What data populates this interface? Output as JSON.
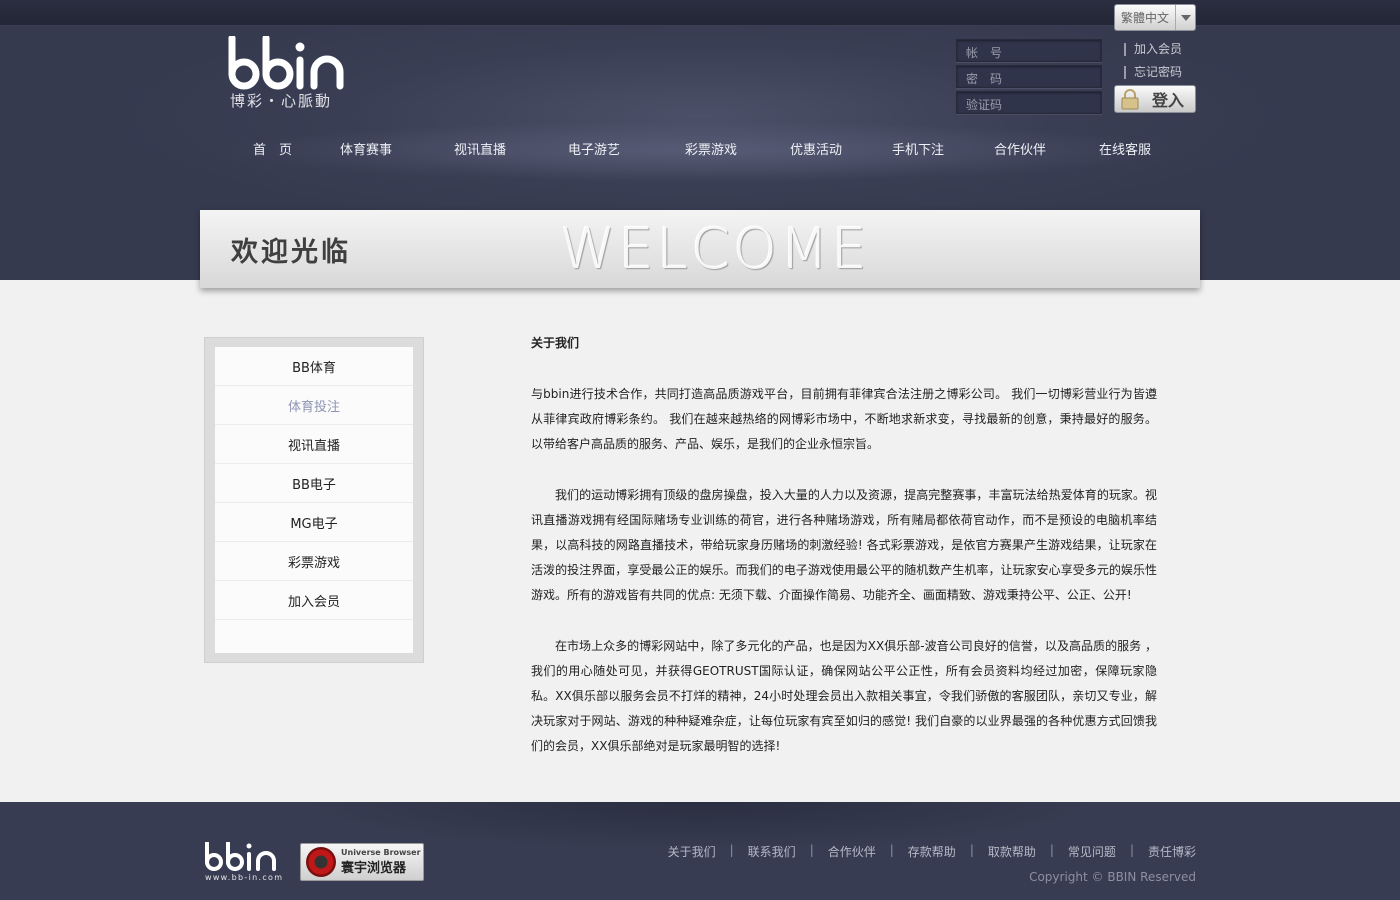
{
  "header": {
    "language_select": "繁體中文",
    "logo_tagline": "博彩・心脈動",
    "login": {
      "account_placeholder": "帐　号",
      "password_placeholder": "密　码",
      "captcha_placeholder": "验证码",
      "join_link": "加入会员",
      "forgot_link": "忘记密码",
      "login_button": "登入"
    },
    "nav": [
      "首　页",
      "体育赛事",
      "视讯直播",
      "电子游艺",
      "彩票游戏",
      "优惠活动",
      "手机下注",
      "合作伙伴",
      "在线客服"
    ]
  },
  "banner": {
    "title_cn": "欢迎光临",
    "title_en": "WELCOME"
  },
  "sidebar": {
    "items": [
      "BB体育",
      "体育投注",
      "视讯直播",
      "BB电子",
      "MG电子",
      "彩票游戏",
      "加入会员"
    ],
    "active_index": 1
  },
  "content": {
    "heading": "关于我们",
    "paragraphs": [
      "与bbin进行技术合作，共同打造高品质游戏平台，目前拥有菲律宾合法注册之博彩公司。 我们一切博彩营业行为皆遵从菲律宾政府博彩条约。 我们在越来越热络的网博彩市场中，不断地求新求变，寻找最新的创意，秉持最好的服务。以带给客户高品质的服务、产品、娱乐，是我们的企业永恒宗旨。",
      "我们的运动博彩拥有顶级的盘房操盘，投入大量的人力以及资源，提高完整赛事，丰富玩法给热爱体育的玩家。视讯直播游戏拥有经国际赌场专业训练的荷官，进行各种赌场游戏，所有赌局都依荷官动作，而不是预设的电脑机率结果，以高科技的网路直播技术，带给玩家身历赌场的刺激经验! 各式彩票游戏，是依官方赛果产生游戏结果，让玩家在活泼的投注界面，享受最公正的娱乐。而我们的电子游戏使用最公平的随机数产生机率，让玩家安心享受多元的娱乐性游戏。所有的游戏皆有共同的优点: 无须下载、介面操作简易、功能齐全、画面精致、游戏秉持公平、公正、公开!",
      "在市场上众多的博彩网站中，除了多元化的产品，也是因为XX俱乐部-波音公司良好的信誉，以及高品质的服务 ，我们的用心随处可见，并获得GEOTRUST国际认证，确保网站公平公正性，所有会员资料均经过加密，保障玩家隐私。XX俱乐部以服务会员不打烊的精神，24小时处理会员出入款相关事宜，令我们骄傲的客服团队，亲切又专业，解决玩家对于网站、游戏的种种疑难杂症，让每位玩家有宾至如归的感觉! 我们自豪的以业界最强的各种优惠方式回馈我们的会员，XX俱乐部绝对是玩家最明智的选择!"
    ]
  },
  "footer": {
    "logo_url_text": "www.bb-in.com",
    "browser_badge": {
      "line1": "Universe Browser",
      "line2": "寰宇浏览器"
    },
    "links": [
      "关于我们",
      "联系我们",
      "合作伙伴",
      "存款帮助",
      "取款帮助",
      "常见问题",
      "责任博彩"
    ],
    "copyright": "Copyright © BBIN Reserved"
  },
  "colors": {
    "header_bg": "#3a3e54",
    "footer_bg": "#383c52",
    "active_sidebar": "#8f95b3"
  }
}
